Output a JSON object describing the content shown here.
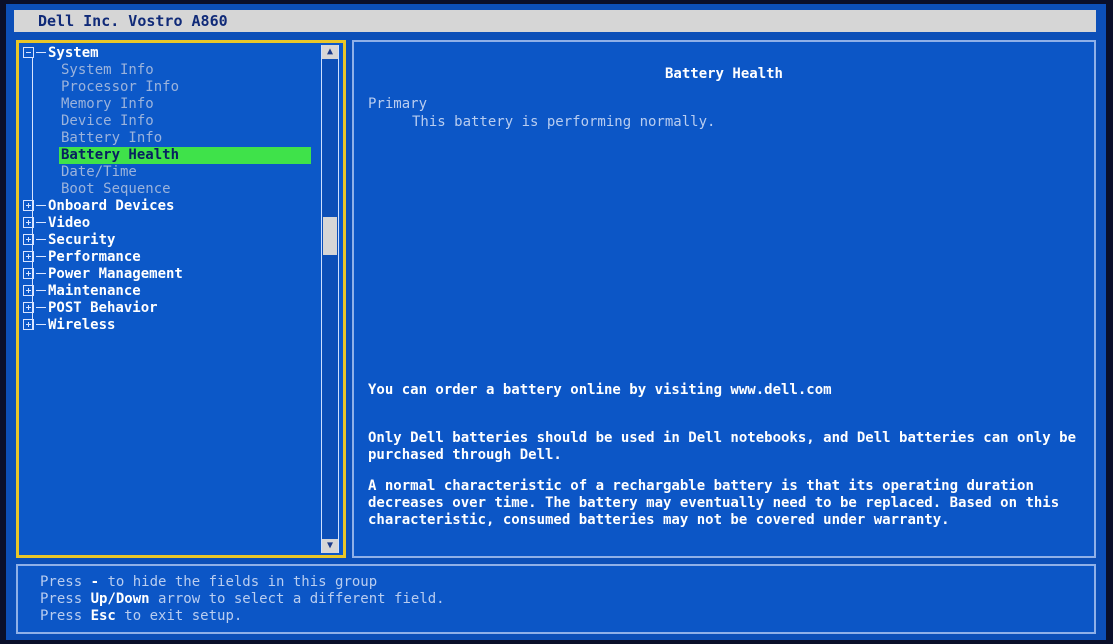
{
  "window": {
    "title": "Dell Inc. Vostro A860"
  },
  "tree": {
    "items": [
      {
        "label": "System",
        "level": 0,
        "expanded": true
      },
      {
        "label": "System Info",
        "level": 1
      },
      {
        "label": "Processor Info",
        "level": 1
      },
      {
        "label": "Memory Info",
        "level": 1
      },
      {
        "label": "Device Info",
        "level": 1
      },
      {
        "label": "Battery Info",
        "level": 1
      },
      {
        "label": "Battery Health",
        "level": 1,
        "selected": true
      },
      {
        "label": "Date/Time",
        "level": 1
      },
      {
        "label": "Boot Sequence",
        "level": 1
      },
      {
        "label": "Onboard Devices",
        "level": 0,
        "expanded": false
      },
      {
        "label": "Video",
        "level": 0,
        "expanded": false
      },
      {
        "label": "Security",
        "level": 0,
        "expanded": false
      },
      {
        "label": "Performance",
        "level": 0,
        "expanded": false
      },
      {
        "label": "Power Management",
        "level": 0,
        "expanded": false
      },
      {
        "label": "Maintenance",
        "level": 0,
        "expanded": false
      },
      {
        "label": "POST Behavior",
        "level": 0,
        "expanded": false
      },
      {
        "label": "Wireless",
        "level": 0,
        "expanded": false
      }
    ]
  },
  "detail": {
    "title": "Battery Health",
    "primary_label": "Primary",
    "status": "This battery is performing normally.",
    "paragraph1": "You can order a battery online by visiting www.dell.com",
    "paragraph2": "Only Dell batteries should be used in Dell notebooks, and Dell batteries can only be purchased through Dell.",
    "paragraph3": "A normal characteristic of a rechargable battery is that its operating duration decreases over time.  The battery may eventually need to be replaced.  Based on this characteristic, consumed batteries may not be covered under warranty."
  },
  "help": {
    "line1_a": "Press ",
    "line1_key": "-",
    "line1_b": " to hide the fields in this group",
    "line2_a": "Press ",
    "line2_key": "Up/Down",
    "line2_b": " arrow to select a different field.",
    "line3_a": "Press ",
    "line3_key": "Esc",
    "line3_b": " to exit setup."
  },
  "colors": {
    "background": "#0c4fb8",
    "selection": "#3fe24a",
    "focus_border": "#e9c628"
  }
}
